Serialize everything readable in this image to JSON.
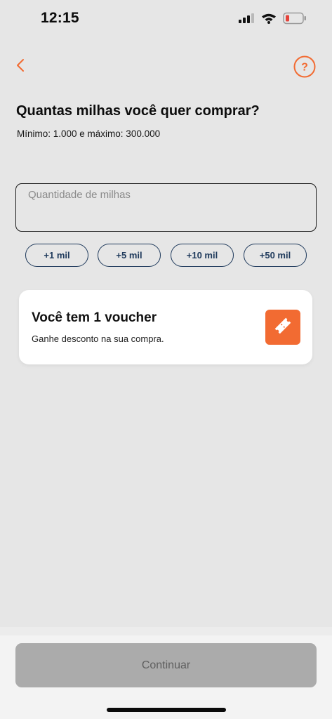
{
  "status_bar": {
    "time": "12:15",
    "icons": [
      "signal-icon",
      "wifi-icon",
      "battery-low-icon"
    ]
  },
  "header": {
    "back_icon": "chevron-left-icon",
    "help_icon": "question-circle-icon",
    "help_glyph": "?"
  },
  "main": {
    "title": "Quantas milhas você quer comprar?",
    "subtitle": "Mínimo: 1.000 e máximo: 300.000",
    "input": {
      "placeholder": "Quantidade de milhas",
      "value": ""
    },
    "chips": [
      {
        "label": "+1 mil"
      },
      {
        "label": "+5 mil"
      },
      {
        "label": "+10 mil"
      },
      {
        "label": "+50 mil"
      }
    ],
    "voucher": {
      "title": "Você tem 1 voucher",
      "description": "Ganhe desconto na sua compra.",
      "icon": "ticket-icon"
    }
  },
  "footer": {
    "continue_label": "Continuar"
  },
  "colors": {
    "accent": "#f26b32",
    "chip_border": "#1f3a5c",
    "background": "#e6e6e6",
    "disabled_button": "#ababab"
  }
}
